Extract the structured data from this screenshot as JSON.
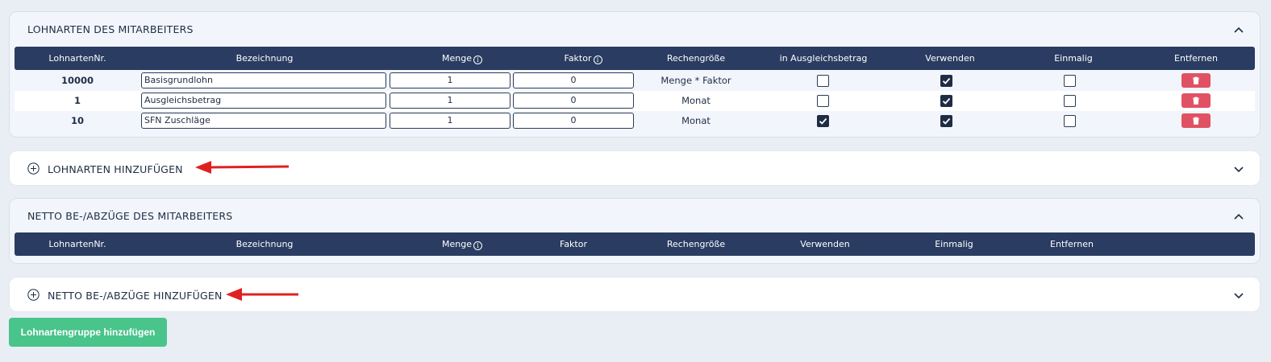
{
  "lohnarten_card": {
    "title": "LOHNARTEN DES MITARBEITERS",
    "columns": {
      "nr": "LohnartenNr.",
      "bezeichnung": "Bezeichnung",
      "menge": "Menge",
      "faktor": "Faktor",
      "rechengroesse": "Rechengröße",
      "ausgleich": "in Ausgleichsbetrag",
      "verwenden": "Verwenden",
      "einmalig": "Einmalig",
      "entfernen": "Entfernen"
    },
    "rows": [
      {
        "nr": "10000",
        "bezeichnung": "Basisgrundlohn",
        "menge": "1",
        "faktor": "0",
        "rechengroesse": "Menge * Faktor",
        "ausgleich": false,
        "verwenden": true,
        "einmalig": false
      },
      {
        "nr": "1",
        "bezeichnung": "Ausgleichsbetrag",
        "menge": "1",
        "faktor": "0",
        "rechengroesse": "Monat",
        "ausgleich": false,
        "verwenden": true,
        "einmalig": false
      },
      {
        "nr": "10",
        "bezeichnung": "SFN Zuschläge",
        "menge": "1",
        "faktor": "0",
        "rechengroesse": "Monat",
        "ausgleich": true,
        "verwenden": true,
        "einmalig": false
      }
    ]
  },
  "lohnarten_add": {
    "label": "LOHNARTEN HINZUFÜGEN"
  },
  "netto_card": {
    "title": "NETTO BE-/ABZÜGE DES MITARBEITERS",
    "columns": {
      "nr": "LohnartenNr.",
      "bezeichnung": "Bezeichnung",
      "menge": "Menge",
      "faktor": "Faktor",
      "rechengroesse": "Rechengröße",
      "verwenden": "Verwenden",
      "einmalig": "Einmalig",
      "entfernen": "Entfernen"
    }
  },
  "netto_add": {
    "label": "NETTO BE-/ABZÜGE HINZUFÜGEN"
  },
  "add_group_button": "Lohnartengruppe hinzufügen",
  "colors": {
    "header_bg": "#2a3c61",
    "delete_button": "#e05263",
    "add_group_button": "#49c48b",
    "arrow": "#e02020"
  }
}
